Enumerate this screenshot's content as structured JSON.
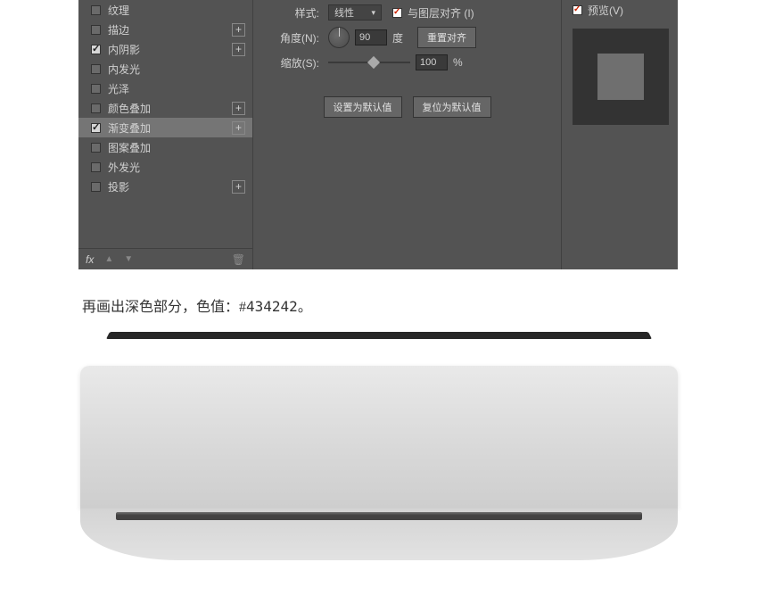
{
  "styles": {
    "items": [
      {
        "label": "纹理",
        "checked": false,
        "hasPlus": false
      },
      {
        "label": "描边",
        "checked": false,
        "hasPlus": true
      },
      {
        "label": "内阴影",
        "checked": true,
        "hasPlus": true
      },
      {
        "label": "内发光",
        "checked": false,
        "hasPlus": false
      },
      {
        "label": "光泽",
        "checked": false,
        "hasPlus": false
      },
      {
        "label": "颜色叠加",
        "checked": false,
        "hasPlus": true
      },
      {
        "label": "渐变叠加",
        "checked": true,
        "hasPlus": true,
        "selected": true
      },
      {
        "label": "图案叠加",
        "checked": false,
        "hasPlus": false
      },
      {
        "label": "外发光",
        "checked": false,
        "hasPlus": false
      },
      {
        "label": "投影",
        "checked": false,
        "hasPlus": true
      }
    ],
    "fx_label": "fx"
  },
  "settings": {
    "style_label": "样式:",
    "style_value": "线性",
    "align_checked": true,
    "align_label": "与图层对齐 (I)",
    "angle_label": "角度(N):",
    "angle_value": "90",
    "angle_unit": "度",
    "reset_align_btn": "重置对齐",
    "scale_label": "缩放(S):",
    "scale_value": "100",
    "scale_unit": "%",
    "set_default_btn": "设置为默认值",
    "restore_default_btn": "复位为默认值"
  },
  "preview": {
    "checked": true,
    "label": "预览(V)"
  },
  "article": {
    "text_prefix": "再画出深色部分，色值：#",
    "color_code": "434242",
    "text_suffix": "。"
  }
}
